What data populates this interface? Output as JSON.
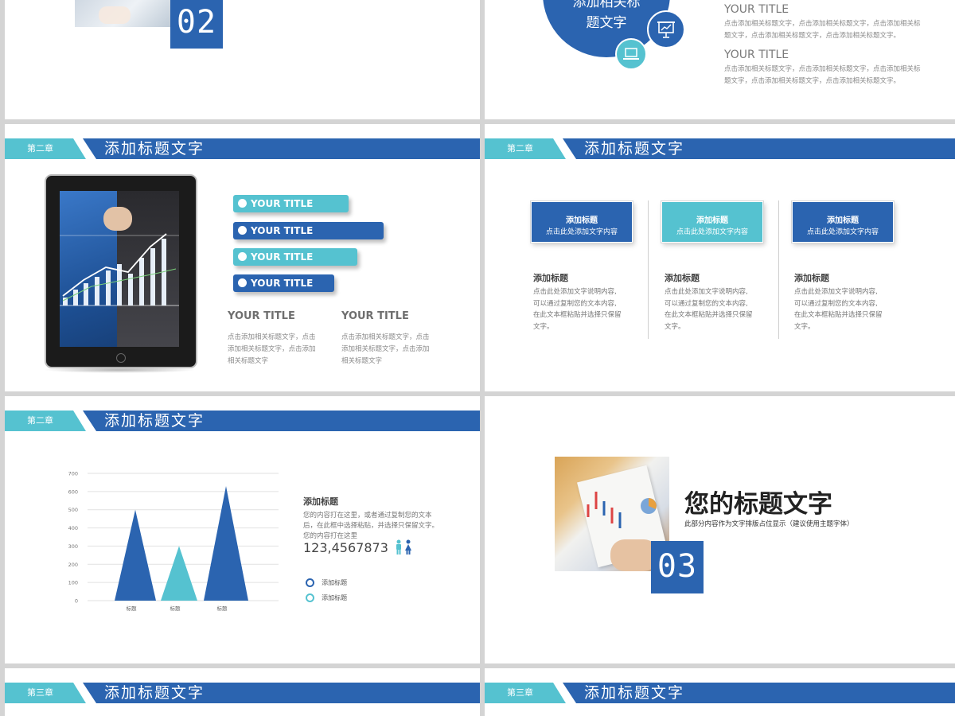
{
  "colors": {
    "blue": "#2b64b0",
    "cyan": "#55c2d0",
    "bg": "#d4d4d4"
  },
  "slide_top_left": {
    "number": "02"
  },
  "slide_top_right": {
    "circle_text_line1": "添加相关标",
    "circle_text_line2": "题文字",
    "icons": [
      "presentation-board-icon",
      "laptop-icon"
    ],
    "items": [
      {
        "title": "YOUR TITLE",
        "line1": "点击添加相关标题文字，点击添加相关标题文字，点击添加相关标",
        "line2": "题文字，点击添加相关标题文字，点击添加相关标题文字。"
      },
      {
        "title": "YOUR TITLE",
        "line1": "点击添加相关标题文字，点击添加相关标题文字，点击添加相关标",
        "line2": "题文字，点击添加相关标题文字，点击添加相关标题文字。"
      }
    ]
  },
  "slide_tablet": {
    "chapter": "第二章",
    "title": "添加标题文字",
    "pills": [
      "YOUR TITLE",
      "YOUR TITLE",
      "YOUR TITLE",
      "YOUR TITLE"
    ],
    "columns": [
      {
        "title": "YOUR TITLE",
        "lines": [
          "点击添加相关标题文字，点击",
          "添加相关标题文字，点击添加",
          "相关标题文字"
        ]
      },
      {
        "title": "YOUR TITLE",
        "lines": [
          "点击添加相关标题文字，点击",
          "添加相关标题文字，点击添加",
          "相关标题文字"
        ]
      }
    ]
  },
  "slide_boxes": {
    "chapter": "第二章",
    "title": "添加标题文字",
    "columns": [
      {
        "box_title": "添加标题",
        "box_sub": "点击此处添加文字内容",
        "heading": "添加标题",
        "lines": [
          "点击此处添加文字说明内容,",
          "可以通过复制您的文本内容,",
          "在此文本框粘贴并选择只保留",
          "文字。"
        ]
      },
      {
        "box_title": "添加标题",
        "box_sub": "点击此处添加文字内容",
        "heading": "添加标题",
        "lines": [
          "点击此处添加文字说明内容,",
          "可以通过复制您的文本内容,",
          "在此文本框粘贴并选择只保留",
          "文字。"
        ]
      },
      {
        "box_title": "添加标题",
        "box_sub": "点击此处添加文字内容",
        "heading": "添加标题",
        "lines": [
          "点击此处添加文字说明内容,",
          "可以通过复制您的文本内容,",
          "在此文本框粘贴并选择只保留",
          "文字。"
        ]
      }
    ]
  },
  "slide_chart": {
    "chapter": "第二章",
    "title": "添加标题文字",
    "side_title": "添加标题",
    "side_lines": [
      "您的内容打在这里，或者通过复制您的文本",
      "后，在此框中选择粘贴，并选择只保留文字。",
      "您的内容打在这里"
    ],
    "big_number": "123,4567873",
    "people_icons": [
      "male-icon",
      "female-icon"
    ],
    "legend": [
      {
        "label": "添加标题",
        "color": "#2b64b0"
      },
      {
        "label": "添加标题",
        "color": "#55c2d0"
      }
    ]
  },
  "chart_data": {
    "type": "bar",
    "categories": [
      "标题",
      "标题",
      "标题"
    ],
    "values": [
      500,
      300,
      630
    ],
    "colors": [
      "#2b64b0",
      "#55c2d0",
      "#2b64b0"
    ],
    "ylim": [
      0,
      700
    ],
    "yticks": [
      "0",
      "100",
      "200",
      "300",
      "400",
      "500",
      "600",
      "700"
    ],
    "grid": true,
    "bar_shape": "triangle"
  },
  "slide_section3": {
    "big_title": "您的标题文字",
    "subtitle": "此部分内容作为文字排版占位显示（建议使用主题字体）",
    "number": "03"
  },
  "slide_bottom_left": {
    "chapter": "第三章",
    "title": "添加标题文字"
  },
  "slide_bottom_right": {
    "chapter": "第三章",
    "title": "添加标题文字"
  }
}
